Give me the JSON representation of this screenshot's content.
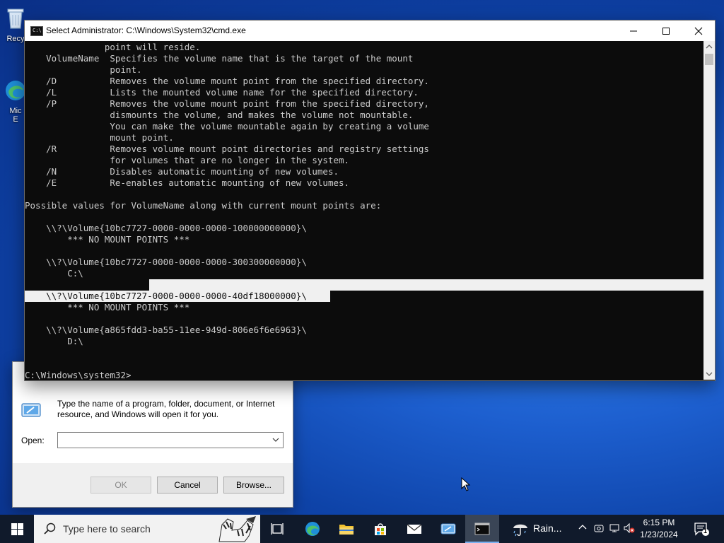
{
  "desktop": {
    "icons": [
      {
        "label": "Recy"
      },
      {
        "label": "Mic\nE"
      }
    ]
  },
  "run_dialog": {
    "description": "Type the name of a program, folder, document, or Internet resource, and Windows will open it for you.",
    "open_label": "Open:",
    "open_value": "",
    "ok_label": "OK",
    "cancel_label": "Cancel",
    "browse_label": "Browse..."
  },
  "cmd": {
    "title": "Select Administrator: C:\\Windows\\System32\\cmd.exe",
    "lines": [
      "               point will reside.",
      "    VolumeName  Specifies the volume name that is the target of the mount",
      "                point.",
      "    /D          Removes the volume mount point from the specified directory.",
      "    /L          Lists the mounted volume name for the specified directory.",
      "    /P          Removes the volume mount point from the specified directory,",
      "                dismounts the volume, and makes the volume not mountable.",
      "                You can make the volume mountable again by creating a volume",
      "                mount point.",
      "    /R          Removes volume mount point directories and registry settings",
      "                for volumes that are no longer in the system.",
      "    /N          Disables automatic mounting of new volumes.",
      "    /E          Re-enables automatic mounting of new volumes.",
      "",
      "Possible values for VolumeName along with current mount points are:",
      "",
      "    \\\\?\\Volume{10bc7727-0000-0000-0000-100000000000}\\",
      "        *** NO MOUNT POINTS ***",
      "",
      "    \\\\?\\Volume{10bc7727-0000-0000-0000-300300000000}\\",
      "        C:\\",
      "",
      "    \\\\?\\Volume{10bc7727-0000-0000-0000-40df18000000}\\",
      "        *** NO MOUNT POINTS ***",
      "",
      "    \\\\?\\Volume{a865fdd3-ba55-11ee-949d-806e6f6e6963}\\",
      "        D:\\",
      "",
      "",
      "C:\\Windows\\system32>"
    ],
    "selected_line_index": 22
  },
  "taskbar": {
    "search_placeholder": "Type here to search",
    "weather": "Rain...",
    "time": "6:15 PM",
    "date": "1/23/2024",
    "notification_count": "1"
  },
  "colors": {
    "console_bg": "#0c0c0c",
    "console_fg": "#cccccc",
    "taskbar_bg": "#101a2b"
  }
}
